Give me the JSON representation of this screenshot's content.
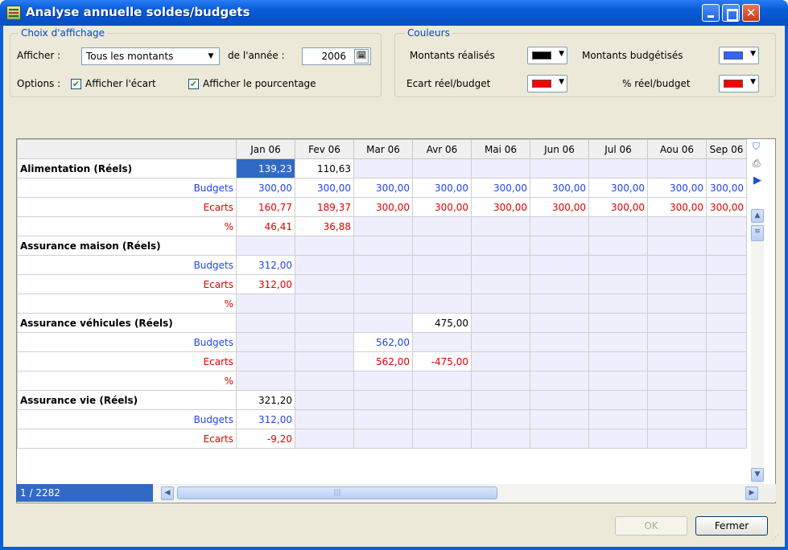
{
  "window": {
    "title": "Analyse annuelle soldes/budgets"
  },
  "display": {
    "legend": "Choix d'affichage",
    "afficher_label": "Afficher :",
    "afficher_value": "Tous les montants",
    "annee_label": "de l'année :",
    "annee_value": "2006",
    "options_label": "Options :",
    "opt_ecart": "Afficher l'écart",
    "opt_pourcentage": "Afficher le pourcentage"
  },
  "colors": {
    "legend": "Couleurs",
    "realises_label": "Montants réalisés",
    "realises_color": "#000000",
    "budgetises_label": "Montants budgétisés",
    "budgetises_color": "#3366ff",
    "ecart_label": "Ecart réel/budget",
    "ecart_color": "#ff0000",
    "pct_label": "% réel/budget",
    "pct_color": "#ff0000"
  },
  "grid": {
    "columns": [
      "Jan 06",
      "Fev 06",
      "Mar 06",
      "Avr 06",
      "Mai 06",
      "Jun 06",
      "Jul 06",
      "Aou 06",
      "Sep 06"
    ],
    "rows": [
      {
        "label": "Alimentation (Réels)",
        "kind": "cat",
        "cells": [
          "139,23",
          "110,63",
          "",
          "",
          "",
          "",
          "",
          "",
          ""
        ]
      },
      {
        "label": "Budgets",
        "kind": "budget",
        "cells": [
          "300,00",
          "300,00",
          "300,00",
          "300,00",
          "300,00",
          "300,00",
          "300,00",
          "300,00",
          "300,00"
        ]
      },
      {
        "label": "Ecarts",
        "kind": "ecart",
        "cells": [
          "160,77",
          "189,37",
          "300,00",
          "300,00",
          "300,00",
          "300,00",
          "300,00",
          "300,00",
          "300,00"
        ]
      },
      {
        "label": "%",
        "kind": "pct",
        "cells": [
          "46,41",
          "36,88",
          "",
          "",
          "",
          "",
          "",
          "",
          ""
        ]
      },
      {
        "label": "Assurance maison (Réels)",
        "kind": "cat",
        "cells": [
          "",
          "",
          "",
          "",
          "",
          "",
          "",
          "",
          ""
        ]
      },
      {
        "label": "Budgets",
        "kind": "budget",
        "cells": [
          "312,00",
          "",
          "",
          "",
          "",
          "",
          "",
          "",
          ""
        ]
      },
      {
        "label": "Ecarts",
        "kind": "ecart",
        "cells": [
          "312,00",
          "",
          "",
          "",
          "",
          "",
          "",
          "",
          ""
        ]
      },
      {
        "label": "%",
        "kind": "pct",
        "cells": [
          "",
          "",
          "",
          "",
          "",
          "",
          "",
          "",
          ""
        ]
      },
      {
        "label": "Assurance véhicules (Réels)",
        "kind": "cat",
        "cells": [
          "",
          "",
          "",
          "475,00",
          "",
          "",
          "",
          "",
          ""
        ]
      },
      {
        "label": "Budgets",
        "kind": "budget",
        "cells": [
          "",
          "",
          "562,00",
          "",
          "",
          "",
          "",
          "",
          ""
        ]
      },
      {
        "label": "Ecarts",
        "kind": "ecart",
        "cells": [
          "",
          "",
          "562,00",
          "-475,00",
          "",
          "",
          "",
          "",
          ""
        ]
      },
      {
        "label": "%",
        "kind": "pct",
        "cells": [
          "",
          "",
          "",
          "",
          "",
          "",
          "",
          "",
          ""
        ]
      },
      {
        "label": "Assurance vie (Réels)",
        "kind": "cat",
        "cells": [
          "321,20",
          "",
          "",
          "",
          "",
          "",
          "",
          "",
          ""
        ]
      },
      {
        "label": "Budgets",
        "kind": "budget",
        "cells": [
          "312,00",
          "",
          "",
          "",
          "",
          "",
          "",
          "",
          ""
        ]
      },
      {
        "label": "Ecarts",
        "kind": "ecart",
        "cells": [
          "-9,20",
          "",
          "",
          "",
          "",
          "",
          "",
          "",
          ""
        ]
      }
    ]
  },
  "status": {
    "counter": "1 / 2282"
  },
  "buttons": {
    "ok": "OK",
    "fermer": "Fermer"
  }
}
